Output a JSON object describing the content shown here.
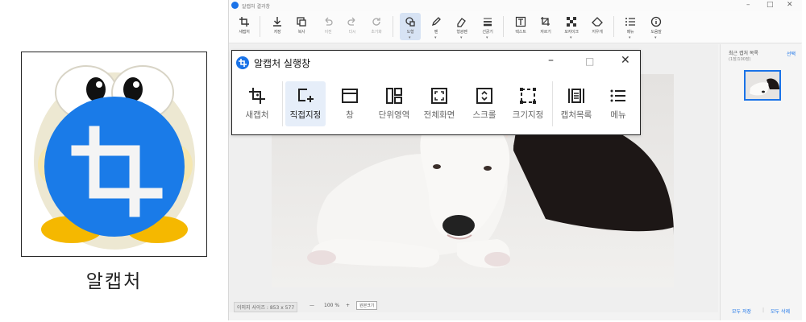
{
  "logo": {
    "caption": "알캡처"
  },
  "window": {
    "title": "알캡처 결과창"
  },
  "toolbar": {
    "items": [
      {
        "label": "새캡처",
        "icon": "new-capture-icon"
      },
      {
        "label": "저장",
        "icon": "download-icon"
      },
      {
        "label": "복사",
        "icon": "copy-icon"
      },
      {
        "label": "이전",
        "icon": "undo-icon"
      },
      {
        "label": "다시",
        "icon": "redo-icon"
      },
      {
        "label": "초기화",
        "icon": "reset-icon"
      },
      {
        "label": "도형",
        "icon": "shape-icon"
      },
      {
        "label": "펜",
        "icon": "pen-icon"
      },
      {
        "label": "형광펜",
        "icon": "highlighter-icon"
      },
      {
        "label": "선굵기",
        "icon": "line-width-icon"
      },
      {
        "label": "텍스트",
        "icon": "text-icon"
      },
      {
        "label": "자르기",
        "icon": "crop-icon"
      },
      {
        "label": "모자이크",
        "icon": "mosaic-icon"
      },
      {
        "label": "지우개",
        "icon": "eraser-icon"
      },
      {
        "label": "메뉴",
        "icon": "menu-icon"
      },
      {
        "label": "도움말",
        "icon": "help-icon"
      }
    ]
  },
  "status": {
    "image_size": "이미지 사이즈 : 853 x 577",
    "zoom_out": "—",
    "zoom": "100 %",
    "zoom_in": "+",
    "fit": "원본크기"
  },
  "side_panel": {
    "title": "최근 캡처 목록",
    "count": "(1장/100장)",
    "select": "선택",
    "save_all": "모두 저장",
    "separator": "|",
    "delete_all": "모두 삭제"
  },
  "launcher": {
    "title": "알캡처 실행창",
    "items": [
      {
        "label": "새캡처",
        "icon": "new-capture-icon"
      },
      {
        "label": "직접지정",
        "icon": "direct-select-icon"
      },
      {
        "label": "창",
        "icon": "window-icon"
      },
      {
        "label": "단위영역",
        "icon": "unit-area-icon"
      },
      {
        "label": "전체화면",
        "icon": "fullscreen-icon"
      },
      {
        "label": "스크롤",
        "icon": "scroll-icon"
      },
      {
        "label": "크기지정",
        "icon": "fixed-size-icon"
      },
      {
        "label": "캡처목록",
        "icon": "capture-list-icon"
      },
      {
        "label": "메뉴",
        "icon": "menu-icon"
      }
    ]
  }
}
